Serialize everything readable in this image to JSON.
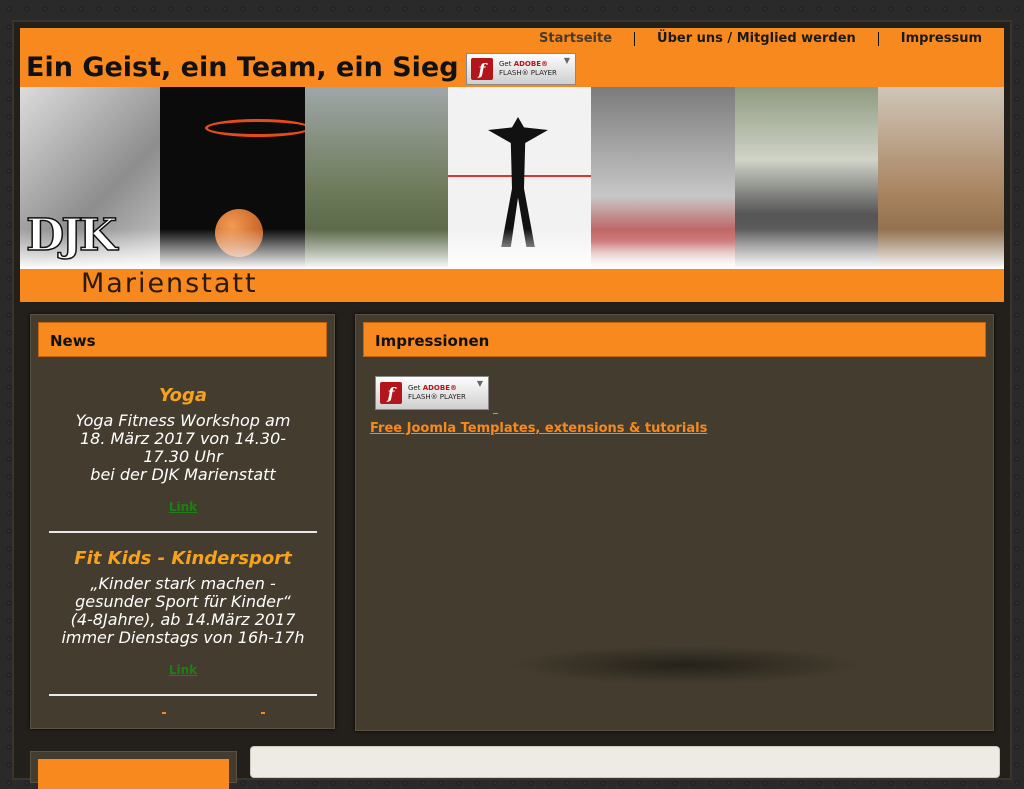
{
  "site": {
    "title": "Ein Geist, ein Team, ein Sieg",
    "logo_text": "DJK",
    "logo_city": "Marienstatt"
  },
  "nav": [
    {
      "label": "Startseite"
    },
    {
      "label": "Über uns / Mitglied werden"
    },
    {
      "label": "Impressum"
    }
  ],
  "flash": {
    "line1_prefix": "Get ",
    "line1_brand": "ADOBE®",
    "line2": "FLASH® PLAYER"
  },
  "news": {
    "heading": "News",
    "items": [
      {
        "title": "Yoga",
        "lines": [
          "Yoga Fitness Workshop am",
          "18. März 2017 von 14.30-",
          "17.30 Uhr",
          "bei der DJK Marienstatt"
        ],
        "link": "Link"
      },
      {
        "title": "Fit Kids - Kindersport",
        "lines": [
          "„Kinder stark machen -",
          "gesunder Sport für Kinder“",
          "(4-8Jahre), ab 14.März 2017",
          "immer Dienstags von 16h-17h"
        ],
        "link": "Link"
      }
    ]
  },
  "impressionen": {
    "heading": "Impressionen",
    "link": "Free Joomla Templates, extensions & tutorials"
  },
  "colors": {
    "accent": "#f7891f",
    "panel": "#443d2f",
    "link_green": "#1f7f14"
  }
}
